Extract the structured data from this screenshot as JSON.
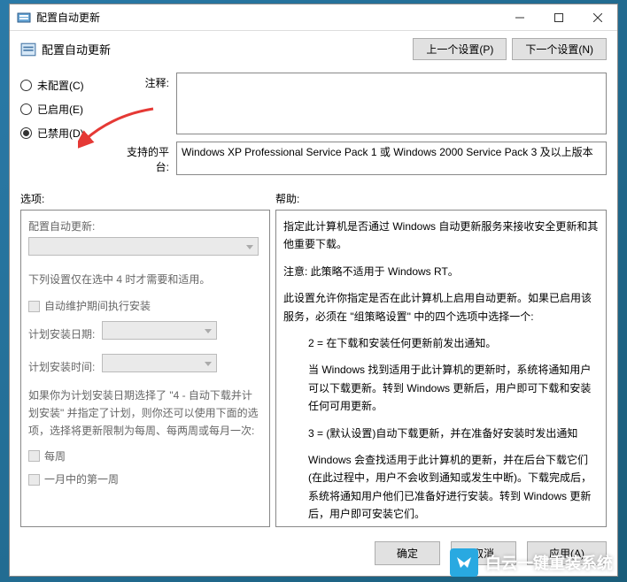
{
  "window": {
    "title": "配置自动更新"
  },
  "header": {
    "title": "配置自动更新",
    "prev_btn": "上一个设置(P)",
    "next_btn": "下一个设置(N)"
  },
  "radios": {
    "not_configured": "未配置(C)",
    "enabled": "已启用(E)",
    "disabled": "已禁用(D)"
  },
  "fields": {
    "comment_label": "注释:",
    "comment_value": "",
    "platform_label": "支持的平台:",
    "platform_value": "Windows XP Professional Service Pack 1 或 Windows 2000 Service Pack 3 及以上版本"
  },
  "section": {
    "options_label": "选项:",
    "help_label": "帮助:"
  },
  "options": {
    "configure_label": "配置自动更新:",
    "note": "下列设置仅在选中 4 时才需要和适用。",
    "maintenance_chk": "自动维护期间执行安装",
    "install_date_label": "计划安装日期:",
    "install_time_label": "计划安装时间:",
    "paragraph": "如果你为计划安装日期选择了 \"4 - 自动下载并计划安装\" 并指定了计划，则你还可以使用下面的选项，选择将更新限制为每周、每两周或每月一次:",
    "weekly_chk": "每周",
    "first_week_chk": "一月中的第一周"
  },
  "help": {
    "p1": "指定此计算机是否通过 Windows 自动更新服务来接收安全更新和其他重要下载。",
    "p2": "注意: 此策略不适用于 Windows RT。",
    "p3": "此设置允许你指定是否在此计算机上启用自动更新。如果已启用该服务，必须在 \"组策略设置\" 中的四个选项中选择一个:",
    "p4": "2 = 在下载和安装任何更新前发出通知。",
    "p5": "当 Windows 找到适用于此计算机的更新时，系统将通知用户可以下载更新。转到 Windows 更新后，用户即可下载和安装任何可用更新。",
    "p6": "3 = (默认设置)自动下载更新，并在准备好安装时发出通知",
    "p7": "Windows 会查找适用于此计算机的更新，并在后台下载它们(在此过程中，用户不会收到通知或发生中断)。下载完成后，系统将通知用户他们已准备好进行安装。转到 Windows 更新后，用户即可安装它们。"
  },
  "footer": {
    "ok": "确定",
    "cancel": "取消",
    "apply": "应用(A)"
  },
  "watermark": "白云一键重装系统"
}
